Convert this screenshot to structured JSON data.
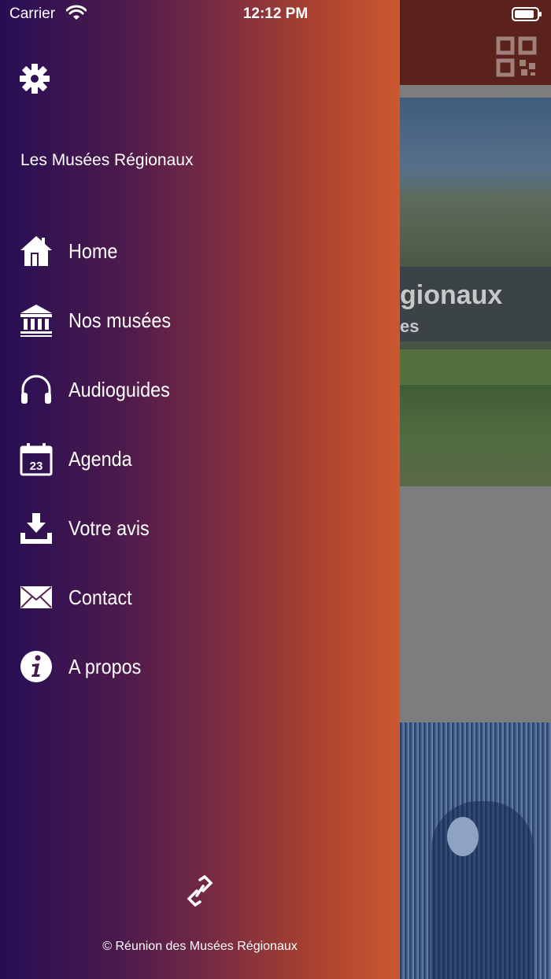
{
  "status_bar": {
    "carrier": "Carrier",
    "time": "12:12 PM"
  },
  "drawer": {
    "title": "Les Musées Régionaux",
    "menu": [
      {
        "label": "Home",
        "icon": "home-icon"
      },
      {
        "label": "Nos musées",
        "icon": "museum-icon"
      },
      {
        "label": "Audioguides",
        "icon": "headphones-icon"
      },
      {
        "label": "Agenda",
        "icon": "calendar-icon",
        "icon_text": "23"
      },
      {
        "label": "Votre avis",
        "icon": "download-icon"
      },
      {
        "label": "Contact",
        "icon": "envelope-icon"
      },
      {
        "label": "A propos",
        "icon": "info-icon"
      }
    ],
    "footer": "© Réunion des Musées Régionaux"
  },
  "background": {
    "hero_text": "gionaux",
    "hero_subtext": "es"
  },
  "colors": {
    "drawer_gradient_start": "#260e55",
    "drawer_gradient_end": "#cc5830",
    "header_bg": "#5a221b"
  }
}
